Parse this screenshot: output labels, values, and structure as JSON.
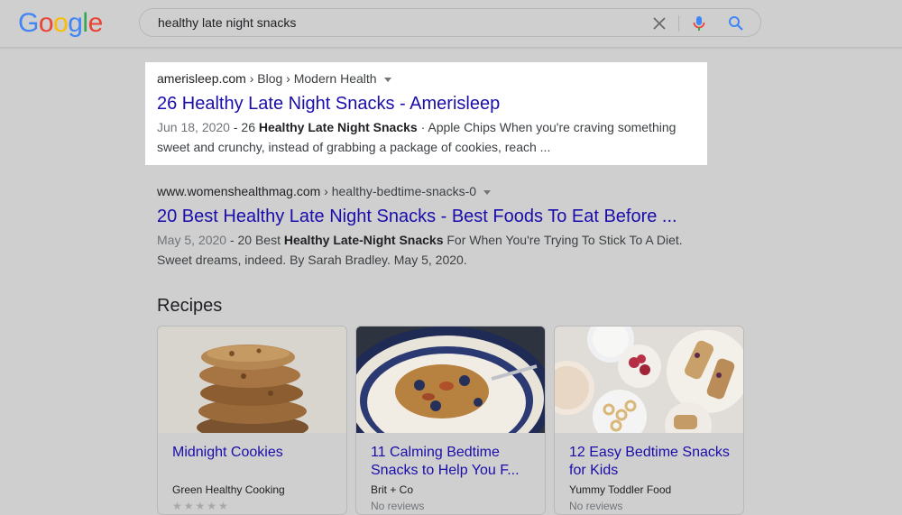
{
  "header": {
    "logo": [
      "G",
      "o",
      "o",
      "g",
      "l",
      "e"
    ],
    "logo_colors": [
      "#4285f4",
      "#ea4335",
      "#fbbc05",
      "#4285f4",
      "#34a853",
      "#ea4335"
    ],
    "search_value": "healthy late night snacks"
  },
  "results": [
    {
      "site": "amerisleep.com",
      "path": " › Blog › Modern Health",
      "title": "26 Healthy Late Night Snacks - Amerisleep",
      "date": "Jun 18, 2020",
      "s1": " - 26 ",
      "b1": "Healthy Late Night Snacks",
      "s2": " · Apple Chips When you're craving something sweet and crunchy, instead of grabbing a package of cookies, reach ..."
    },
    {
      "site": "www.womenshealthmag.com",
      "path": " › healthy-bedtime-snacks-0",
      "title": "20 Best Healthy Late Night Snacks - Best Foods To Eat Before ...",
      "date": "May 5, 2020",
      "s1": " - 20 Best ",
      "b1": "Healthy Late-Night Snacks",
      "s2": " For When You're Trying To Stick To A Diet. Sweet dreams, indeed. By Sarah Bradley. May 5, 2020."
    }
  ],
  "recipes": {
    "heading": "Recipes",
    "cards": [
      {
        "title": "Midnight Cookies",
        "source": "Green Healthy Cooking",
        "stars": "★★★★★"
      },
      {
        "title": "11 Calming Bedtime Snacks to Help You F...",
        "source": "Brit + Co",
        "reviews": "No reviews"
      },
      {
        "title": "12 Easy Bedtime Snacks for Kids",
        "source": "Yummy Toddler Food",
        "reviews": "No reviews"
      }
    ]
  },
  "colors": {
    "link": "#1a0dab",
    "highlight": "#ffffff",
    "background": "#cfcfcf"
  }
}
